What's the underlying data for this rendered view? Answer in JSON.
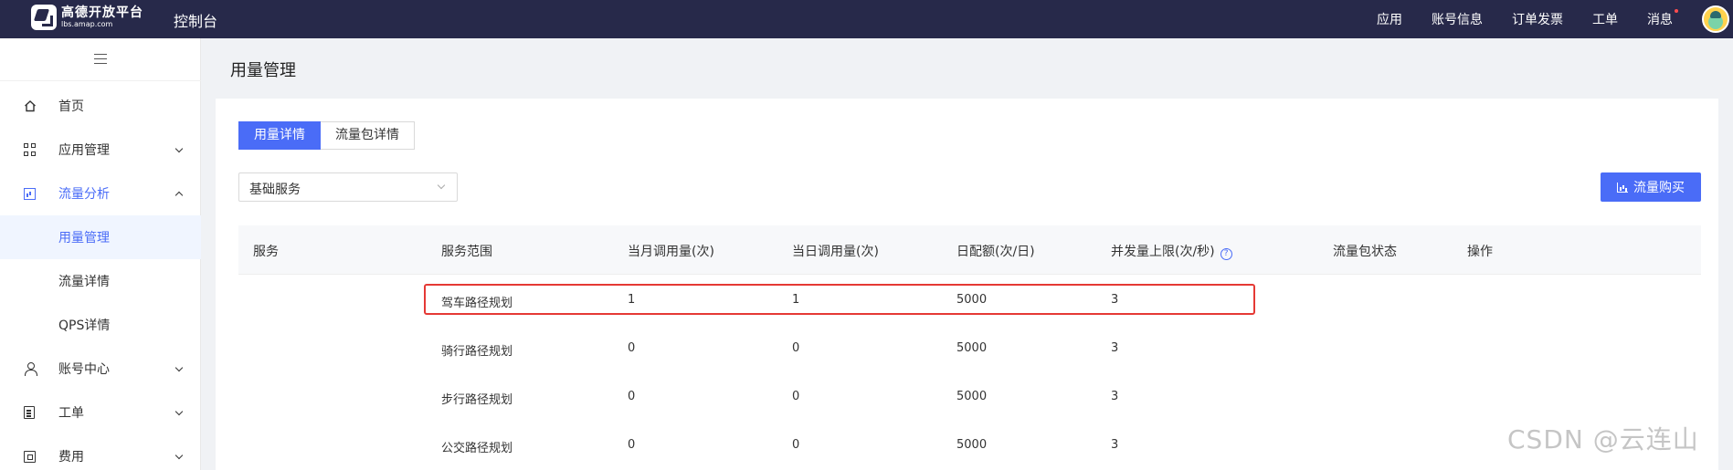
{
  "topbar": {
    "logo_name": "高德开放平台",
    "logo_url": "lbs.amap.com",
    "console_title": "控制台",
    "nav": [
      "应用",
      "账号信息",
      "订单发票",
      "工单",
      "消息"
    ]
  },
  "sidebar": {
    "items": [
      {
        "label": "首页",
        "icon": "home-icon"
      },
      {
        "label": "应用管理",
        "icon": "grid-icon"
      },
      {
        "label": "流量分析",
        "icon": "chart-icon"
      },
      {
        "label": "用量管理"
      },
      {
        "label": "流量详情"
      },
      {
        "label": "QPS详情"
      },
      {
        "label": "账号中心",
        "icon": "user-icon"
      },
      {
        "label": "工单",
        "icon": "document-icon"
      },
      {
        "label": "费用",
        "icon": "fee-icon"
      }
    ]
  },
  "page": {
    "title": "用量管理",
    "tabs": [
      "用量详情",
      "流量包详情"
    ],
    "select_value": "基础服务",
    "buy_button": "流量购买"
  },
  "table": {
    "headers": [
      "服务",
      "服务范围",
      "当月调用量(次)",
      "当日调用量(次)",
      "日配额(次/日)",
      "并发量上限(次/秒)",
      "流量包状态",
      "操作"
    ],
    "rows": [
      [
        "",
        "驾车路径规划",
        "1",
        "1",
        "5000",
        "3",
        "",
        ""
      ],
      [
        "",
        "骑行路径规划",
        "0",
        "0",
        "5000",
        "3",
        "",
        ""
      ],
      [
        "",
        "步行路径规划",
        "0",
        "0",
        "5000",
        "3",
        "",
        ""
      ],
      [
        "",
        "公交路径规划",
        "0",
        "0",
        "5000",
        "3",
        "",
        ""
      ]
    ]
  },
  "watermark": "CSDN @云连山",
  "colors": {
    "topbar": "#27294a",
    "accent": "#4a6cf7",
    "highlight": "#e53935"
  }
}
